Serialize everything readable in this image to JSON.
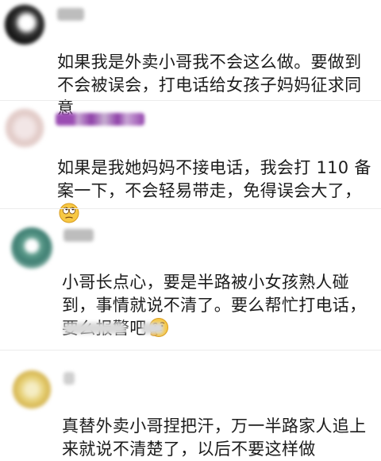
{
  "comments": [
    {
      "text": "如果我是外卖小哥我不会这么做。要做到\n不会被误会，打电话给女孩子妈妈征求同\n意",
      "emoji": ""
    },
    {
      "text": "如果是我她妈妈不接电话，我会打 110 备\n案一下，不会轻易带走，免得误会大了，",
      "emoji": "rolling-eyes-face"
    },
    {
      "text": "小哥长点心，要是半路被小女孩熟人碰\n到，事情就说不清了。要么帮忙打电话，\n要么报警吧",
      "emoji": "thinking-face"
    },
    {
      "text": "真替外卖小哥捏把汗，万一半路家人追上\n来就说不清楚了，以后不要这样做",
      "emoji": ""
    }
  ],
  "colors": {
    "text": "#1c1c1c",
    "name_blur": "#bdbdbd",
    "name_purple": "#8e3fa8",
    "meta_blur": "#d9d9d9"
  }
}
